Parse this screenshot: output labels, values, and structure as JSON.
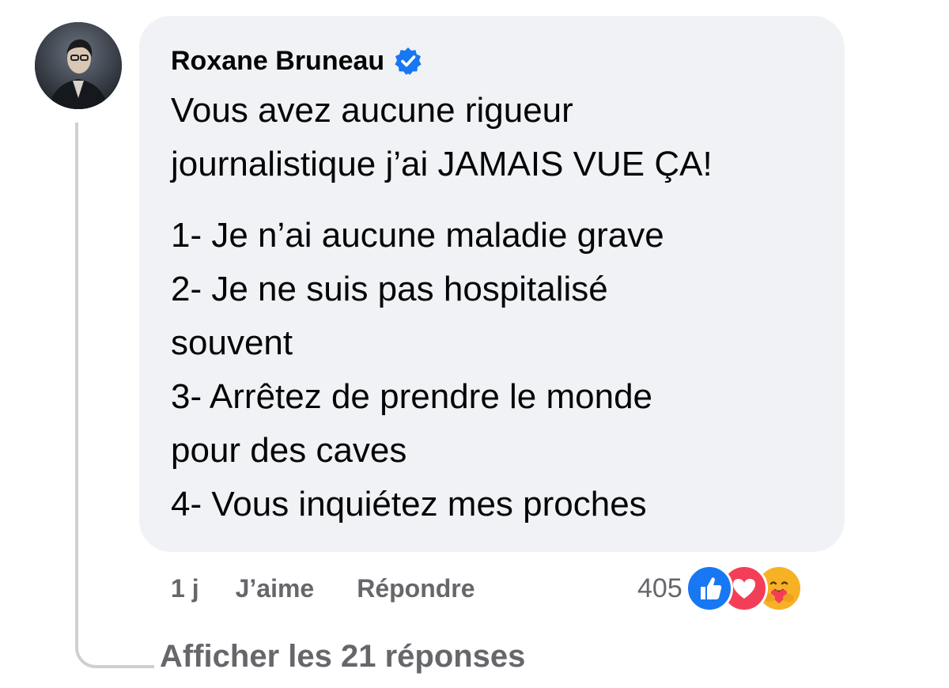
{
  "comment": {
    "author": "Roxane Bruneau",
    "verified_icon": "verified-badge-icon",
    "lines": [
      "Vous avez aucune rigueur",
      "journalistique j’ai JAMAIS VUE ÇA!"
    ],
    "list_lines": [
      "1- Je n’ai aucune maladie grave",
      "2- Je ne suis pas hospitalisé",
      "souvent",
      "3- Arrêtez de prendre le monde",
      "pour des caves",
      "4- Vous inquiétez mes proches"
    ]
  },
  "actions": {
    "time": "1 j",
    "like_label": "J’aime",
    "reply_label": "Répondre"
  },
  "reactions": {
    "count": "405",
    "icons": [
      "like-icon",
      "love-icon",
      "care-icon"
    ]
  },
  "replies": {
    "view_label": "Afficher les 21 réponses"
  },
  "colors": {
    "bubble_bg": "#f0f2f5",
    "text": "#050505",
    "secondary_text": "#65676b",
    "verified_blue": "#1877f2",
    "like_blue": "#1877f2",
    "love_red": "#f33e58",
    "care_yellow": "#f7b125"
  }
}
